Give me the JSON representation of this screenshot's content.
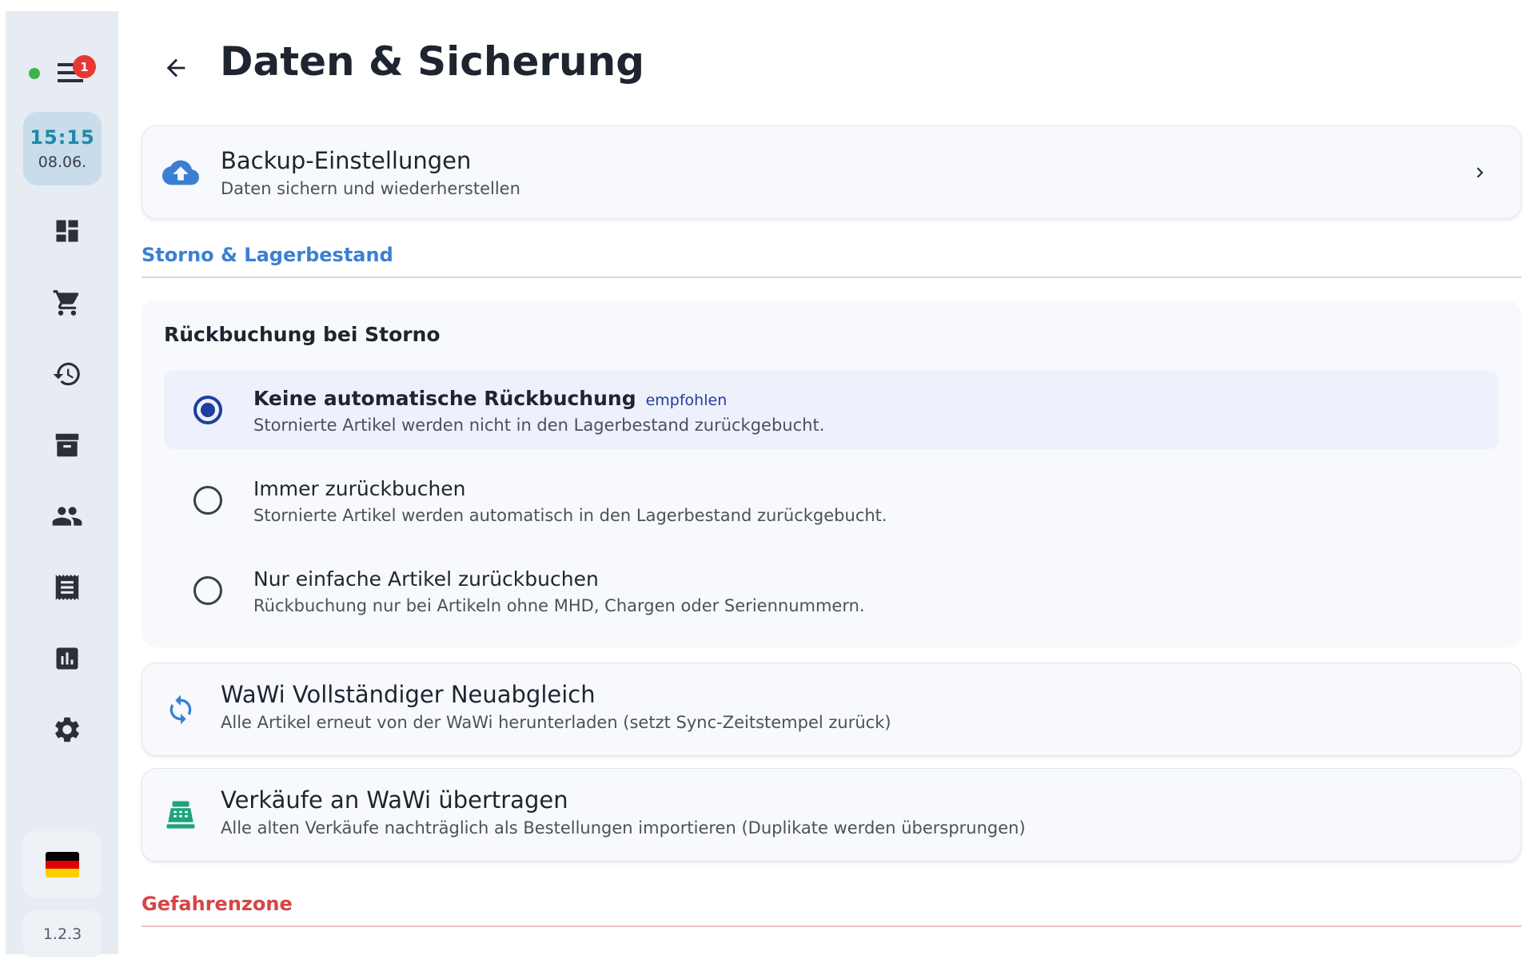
{
  "sidebar": {
    "notification_count": "1",
    "clock_time": "15:15",
    "clock_date": "08.06.",
    "version": "1.2.3",
    "colors": {
      "status": "#3bb54a",
      "badge": "#e53935",
      "clock_bg": "#c8dcec"
    },
    "nav_icons": [
      "dashboard-icon",
      "cart-icon",
      "history-icon",
      "archive-icon",
      "users-icon",
      "receipt-icon",
      "chart-icon",
      "gear-icon"
    ],
    "language_icon": "flag-de-icon"
  },
  "header": {
    "title": "Daten & Sicherung"
  },
  "backup_card": {
    "title": "Backup-Einstellungen",
    "subtitle": "Daten sichern und wiederherstellen",
    "icon": "cloud-upload-icon"
  },
  "section_storno": {
    "label": "Storno & Lagerbestand",
    "color": "#3b7fd4"
  },
  "storno_group": {
    "title": "Rückbuchung bei Storno",
    "options": [
      {
        "title": "Keine automatische Rückbuchung",
        "tag": "empfohlen",
        "subtitle": "Stornierte Artikel werden nicht in den Lagerbestand zurückgebucht.",
        "selected": true
      },
      {
        "title": "Immer zurückbuchen",
        "subtitle": "Stornierte Artikel werden automatisch in den Lagerbestand zurückgebucht.",
        "selected": false
      },
      {
        "title": "Nur einfache Artikel zurückbuchen",
        "subtitle": "Rückbuchung nur bei Artikeln ohne MHD, Chargen oder Seriennummern.",
        "selected": false
      }
    ]
  },
  "wawi_sync_card": {
    "title": "WaWi Vollständiger Neuabgleich",
    "subtitle": "Alle Artikel erneut von der WaWi herunterladen (setzt Sync-Zeitstempel zurück)",
    "icon": "sync-icon"
  },
  "wawi_sales_card": {
    "title": "Verkäufe an WaWi übertragen",
    "subtitle": "Alle alten Verkäufe nachträglich als Bestellungen importieren (Duplikate werden übersprungen)",
    "icon": "cash-register-icon"
  },
  "section_danger": {
    "label": "Gefahrenzone",
    "color": "#d64545"
  }
}
